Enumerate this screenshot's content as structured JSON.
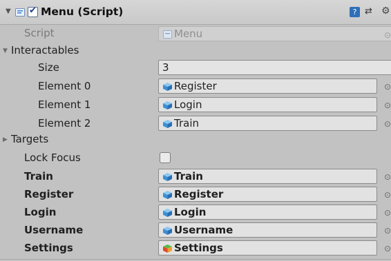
{
  "header": {
    "title": "Menu (Script)",
    "help_glyph": "?",
    "presets_glyph": "⇄",
    "gear_glyph": "⚙",
    "fold_icon": "triangle-down-icon"
  },
  "script_row": {
    "label": "Script",
    "value": "Menu"
  },
  "interactables": {
    "label": "Interactables",
    "size_label": "Size",
    "size_value": "3",
    "elements": [
      {
        "label": "Element 0",
        "value": "Register"
      },
      {
        "label": "Element 1",
        "value": "Login"
      },
      {
        "label": "Element 2",
        "value": "Train"
      }
    ]
  },
  "targets": {
    "label": "Targets"
  },
  "lock_focus": {
    "label": "Lock Focus",
    "checked": false
  },
  "fields": [
    {
      "label": "Train",
      "value": "Train",
      "icon": "cube-blue"
    },
    {
      "label": "Register",
      "value": "Register",
      "icon": "cube-blue"
    },
    {
      "label": "Login",
      "value": "Login",
      "icon": "cube-blue"
    },
    {
      "label": "Username",
      "value": "Username",
      "icon": "cube-blue"
    },
    {
      "label": "Settings",
      "value": "Settings",
      "icon": "cube-colored"
    }
  ],
  "colors": {
    "panel_bg": "#c2c2c2",
    "field_bg": "#e2e2e2",
    "cube_blue": "#3d8fd6",
    "cube_red": "#e0492e",
    "cube_orange": "#f0a030",
    "cube_green": "#5fb84a"
  }
}
